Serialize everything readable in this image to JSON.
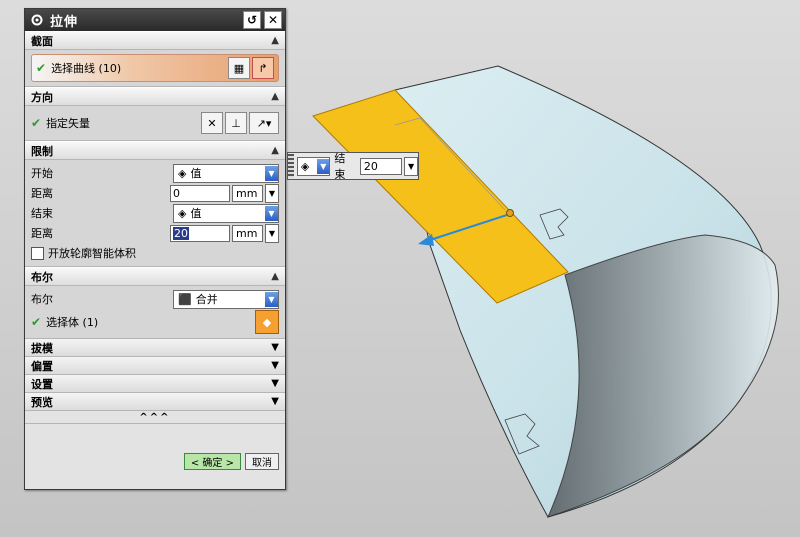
{
  "dialog": {
    "title": "拉伸",
    "sections": {
      "section": {
        "header": "截面",
        "select_curve": "选择曲线 (10)"
      },
      "direction": {
        "header": "方向",
        "specify_vector": "指定矢量"
      },
      "limits": {
        "header": "限制",
        "start_label": "开始",
        "start_type": "值",
        "start_distance_label": "距离",
        "start_distance": "0",
        "start_unit": "mm",
        "end_label": "结束",
        "end_type": "值",
        "end_distance_label": "距离",
        "end_distance": "20",
        "end_unit": "mm",
        "open_profile_label": "开放轮廓智能体积"
      },
      "boolean": {
        "header": "布尔",
        "boolean_label": "布尔",
        "boolean_value": "合并",
        "select_body": "选择体 (1)"
      },
      "draft": {
        "header": "拔模"
      },
      "offset": {
        "header": "偏置"
      },
      "settings": {
        "header": "设置"
      },
      "preview": {
        "header": "预览"
      }
    },
    "more_label": "^^^",
    "ok_label": "< 确定 >",
    "cancel_label": "取消"
  },
  "popup": {
    "label": "结束",
    "value": "20"
  },
  "colors": {
    "face_highlight": "#f5c01a",
    "surface": "#cfe6ec",
    "vector": "#2a8ad8"
  },
  "icons": [
    "gear-icon",
    "reset-icon",
    "close-icon",
    "collapse-icon",
    "expand-icon",
    "check-icon",
    "curve-icon",
    "vector-icon",
    "body-icon",
    "cube-icon"
  ]
}
